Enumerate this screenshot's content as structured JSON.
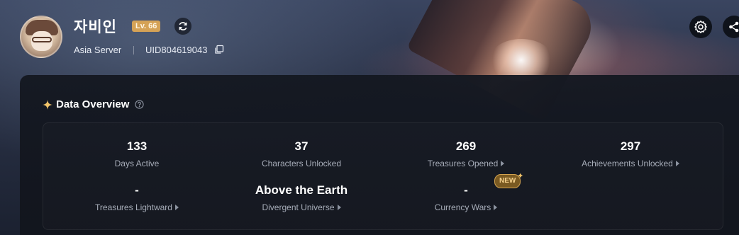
{
  "player": {
    "name": "자비인",
    "level": "Lv. 66",
    "server": "Asia Server",
    "uid": "UID804619043"
  },
  "section": {
    "title": "Data Overview"
  },
  "stats": [
    {
      "value": "133",
      "label": "Days Active",
      "has_arrow": false
    },
    {
      "value": "37",
      "label": "Characters Unlocked",
      "has_arrow": false
    },
    {
      "value": "269",
      "label": "Treasures Opened",
      "has_arrow": true
    },
    {
      "value": "297",
      "label": "Achievements Unlocked",
      "has_arrow": true
    },
    {
      "value": "-",
      "label": "Treasures Lightward",
      "has_arrow": true
    },
    {
      "value": "Above the Earth",
      "label": "Divergent Universe",
      "has_arrow": true
    },
    {
      "value": "-",
      "label": "Currency Wars",
      "has_arrow": true
    }
  ],
  "badges": {
    "new": "NEW"
  },
  "colors": {
    "level_badge": "#d5a256",
    "panel_bg": "#141821",
    "stat_label": "#a7adb9",
    "accent_gold": "#f3c56a"
  },
  "icons": {
    "refresh": "refresh-icon",
    "copy": "copy-icon",
    "settings": "gear-icon",
    "share": "share-icon",
    "sparkle": "sparkle-icon",
    "help": "help-icon"
  }
}
